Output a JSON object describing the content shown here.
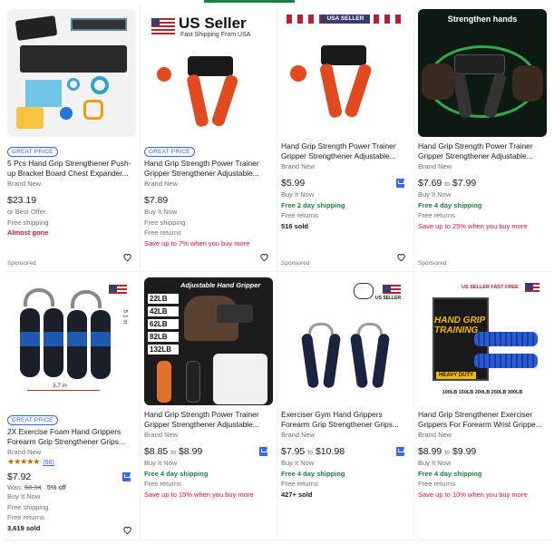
{
  "products": [
    {
      "title": "5 Pcs Hand Grip Strengthener Push-up Bracket Board Chest Expander...",
      "badge": "GREAT PRICE",
      "condition": "Brand New",
      "price": "$23.19",
      "line1": "or Best Offer",
      "line2": "Free shipping",
      "line3": "Almost gone",
      "sponsored": "Sponsored"
    },
    {
      "title": "Hand Grip Strength Power Trainer Gripper Strengthener Adjustable...",
      "badge": "GREAT PRICE",
      "condition": "Brand New",
      "price": "$7.89",
      "line1": "Buy It Now",
      "line2": "Free shipping",
      "line3": "Free returns",
      "line4": "Save up to 7% when you buy more",
      "sponsored": "",
      "img_title": "US Seller",
      "img_sub": "Fast Shipping From USA"
    },
    {
      "title": "Hand Grip Strength Power Trainer Gripper Strengthener Adjustable...",
      "condition": "Brand New",
      "price": "$5.99",
      "line1": "Buy It Now",
      "line2": "Free 2 day shipping",
      "line3": "Free returns",
      "line4": "516 sold",
      "sponsored": "Sponsored",
      "img_title": "USA SELLER"
    },
    {
      "title": "Hand Grip Strength Power Trainer Gripper Strengthener Adjustable...",
      "condition": "Brand New",
      "price_from": "$7.69",
      "price_to": "$7.99",
      "to_word": "to",
      "line1": "Buy It Now",
      "line2": "Free 4 day shipping",
      "line3": "Free returns",
      "line4": "Save up to 25% when you buy more",
      "sponsored": "Sponsored",
      "img_title": "Strengthen hands"
    },
    {
      "title": "2X Exercise Foam Hand Grippers Forearm Grip Strengthener Grips...",
      "badge": "GREAT PRICE",
      "condition": "Brand New",
      "rating_count": "(66)",
      "price": "$7.92",
      "was_label": "Was:",
      "was_price": "$8.34",
      "off": "5% off",
      "line1": "Buy It Now",
      "line2": "Free shipping",
      "line3": "Free returns",
      "line4": "3,619 sold",
      "img_label": "3.7 in",
      "img_label2": "5.1 in"
    },
    {
      "title": "Hand Grip Strength Power Trainer Gripper Strengthener Adjustable...",
      "condition": "Brand New",
      "price_from": "$8.85",
      "price_to": "$8.99",
      "to_word": "to",
      "line1": "Buy It Now",
      "line2": "Free 4 day shipping",
      "line3": "Free returns",
      "line4": "Save up to 15% when you buy more",
      "img_title": "Adjustable Hand Gripper",
      "weights": [
        "22LB",
        "42LB",
        "62LB",
        "82LB",
        "132LB"
      ]
    },
    {
      "title": "Exerciser Gym Hand Grippers Forearm Grip Strengthener Grips...",
      "condition": "Brand New",
      "price_from": "$7.95",
      "price_to": "$10.98",
      "to_word": "to",
      "line1": "Buy It Now",
      "line2": "Free 4 day shipping",
      "line3": "Free returns",
      "line4": "427+ sold",
      "img_title": "US SELLER"
    },
    {
      "title": "Hand Grip Strengthener Exerciser Grippers For Forearm Wrist Grippe...",
      "condition": "Brand New",
      "price_from": "$8.99",
      "price_to": "$9.99",
      "to_word": "to",
      "line1": "Buy It Now",
      "line2": "Free 4 day shipping",
      "line3": "Free returns",
      "line4": "Save up to 10% when you buy more",
      "img_title": "US SELLER FAST FREE",
      "img_big": "HAND GRIP TRAINING",
      "img_heavy": "HEAVY DUTY",
      "img_weights": "100LB  150LB  200LB  250LB  300LB"
    }
  ],
  "colors": {
    "accent": "#3665f3",
    "green": "#1e7f3e",
    "red": "#e0103a"
  }
}
